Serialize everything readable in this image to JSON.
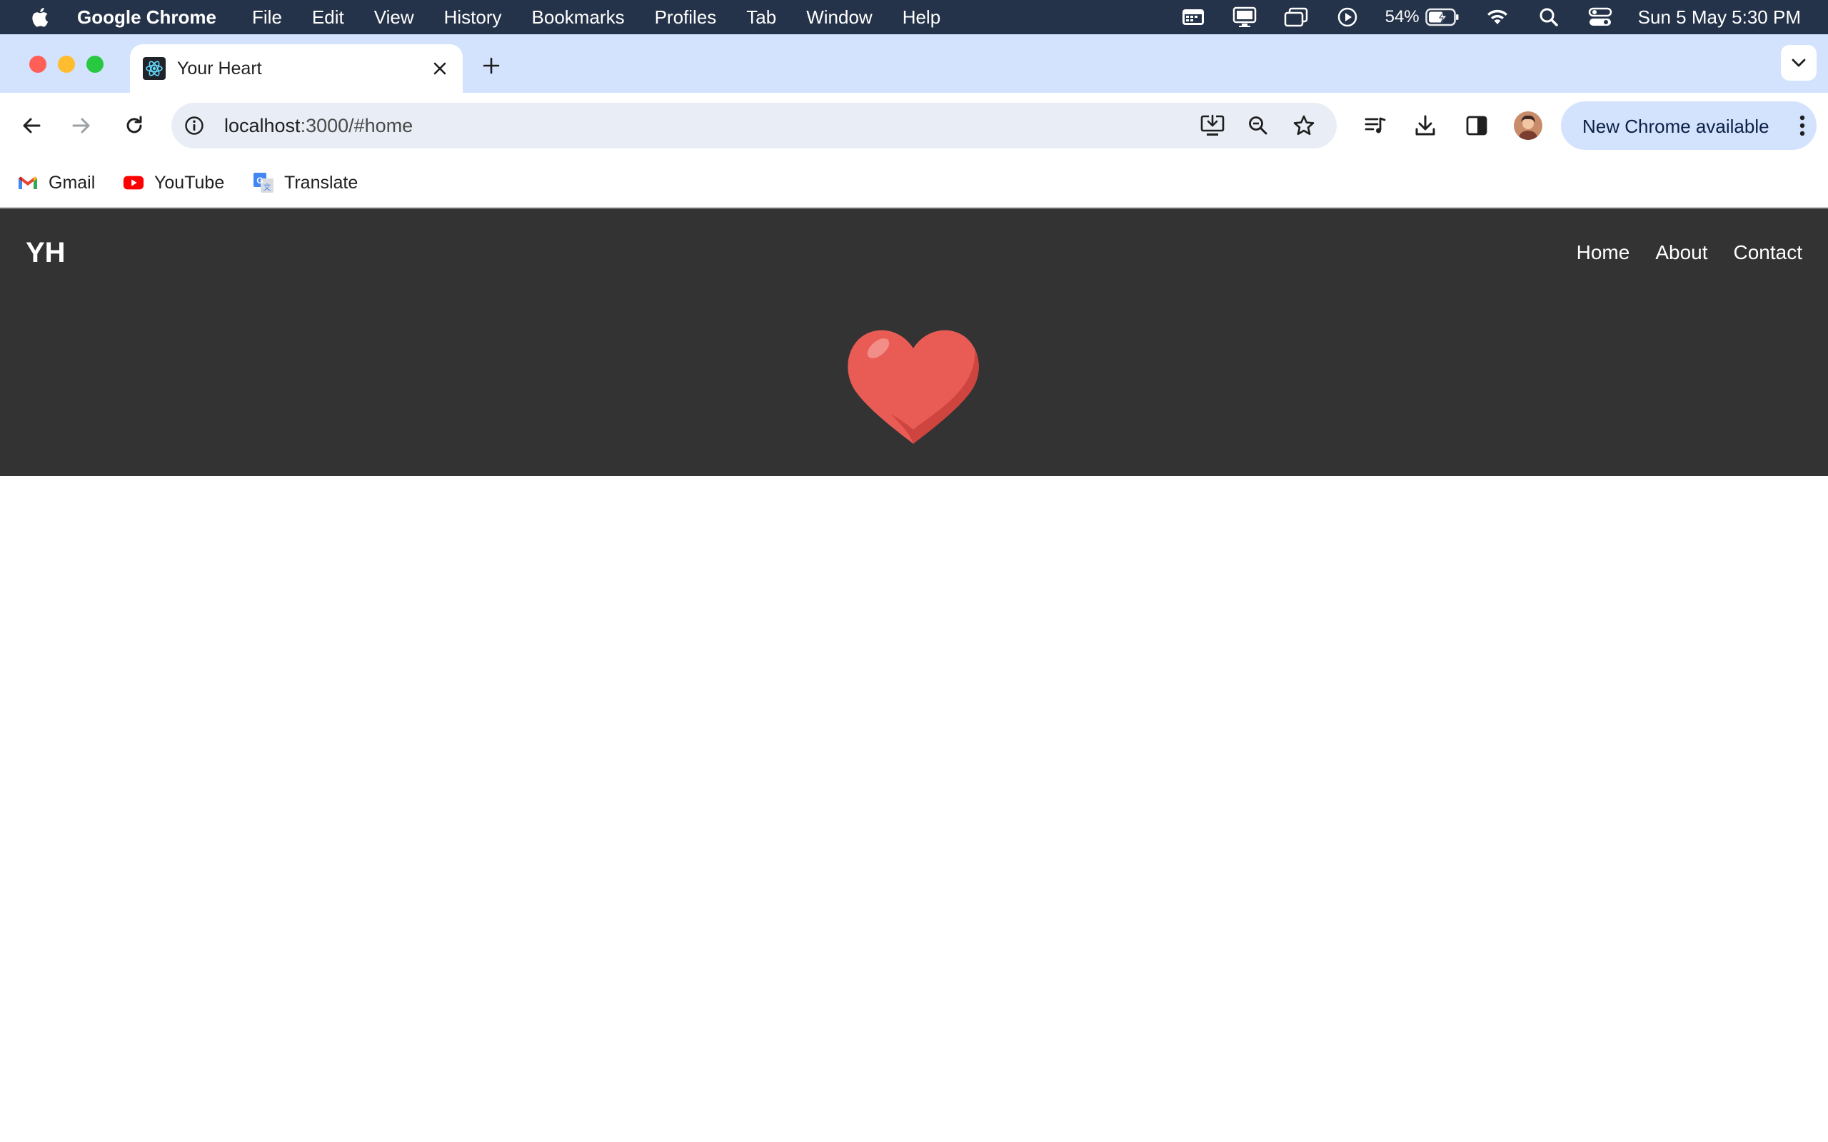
{
  "menubar": {
    "app_name": "Google Chrome",
    "menus": [
      "File",
      "Edit",
      "View",
      "History",
      "Bookmarks",
      "Profiles",
      "Tab",
      "Window",
      "Help"
    ],
    "battery_percent": "54%",
    "clock": "Sun 5 May  5:30 PM",
    "status_icons": [
      "calendar-icon",
      "display-icon",
      "stage-manager-icon",
      "play-icon",
      "battery-icon",
      "wifi-icon",
      "spotlight-search-icon",
      "control-center-icon"
    ]
  },
  "tabs": {
    "active_title": "Your Heart",
    "favicon": "react-icon"
  },
  "toolbar": {
    "url_host": "localhost",
    "url_path": ":3000/#home",
    "update_label": "New Chrome available"
  },
  "bookmarks": [
    {
      "label": "Gmail",
      "icon": "gmail-icon"
    },
    {
      "label": "YouTube",
      "icon": "youtube-icon"
    },
    {
      "label": "Translate",
      "icon": "google-translate-icon"
    }
  ],
  "site": {
    "logo": "YH",
    "nav": [
      "Home",
      "About",
      "Contact"
    ],
    "header_color": "#333333",
    "heart_color": "#e85c55"
  }
}
